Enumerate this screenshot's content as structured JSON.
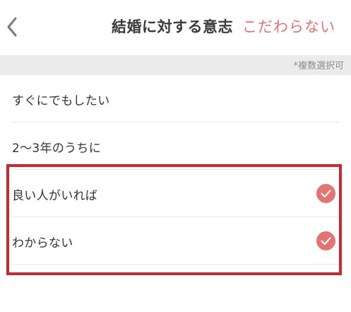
{
  "header": {
    "title": "結婚に対する意志",
    "indifferent_label": "こだわらない"
  },
  "subbar": {
    "note": "*複数選択可"
  },
  "options": [
    {
      "label": "すぐにでもしたい",
      "selected": false
    },
    {
      "label": "2〜3年のうちに",
      "selected": false
    },
    {
      "label": "良い人がいれば",
      "selected": true
    },
    {
      "label": "わからない",
      "selected": true
    }
  ],
  "colors": {
    "accent": "#e57373",
    "highlight": "#d0242e",
    "subbar_bg": "#ebebeb"
  },
  "icons": {
    "back": "chevron-left-icon",
    "check": "check-circle-icon"
  }
}
